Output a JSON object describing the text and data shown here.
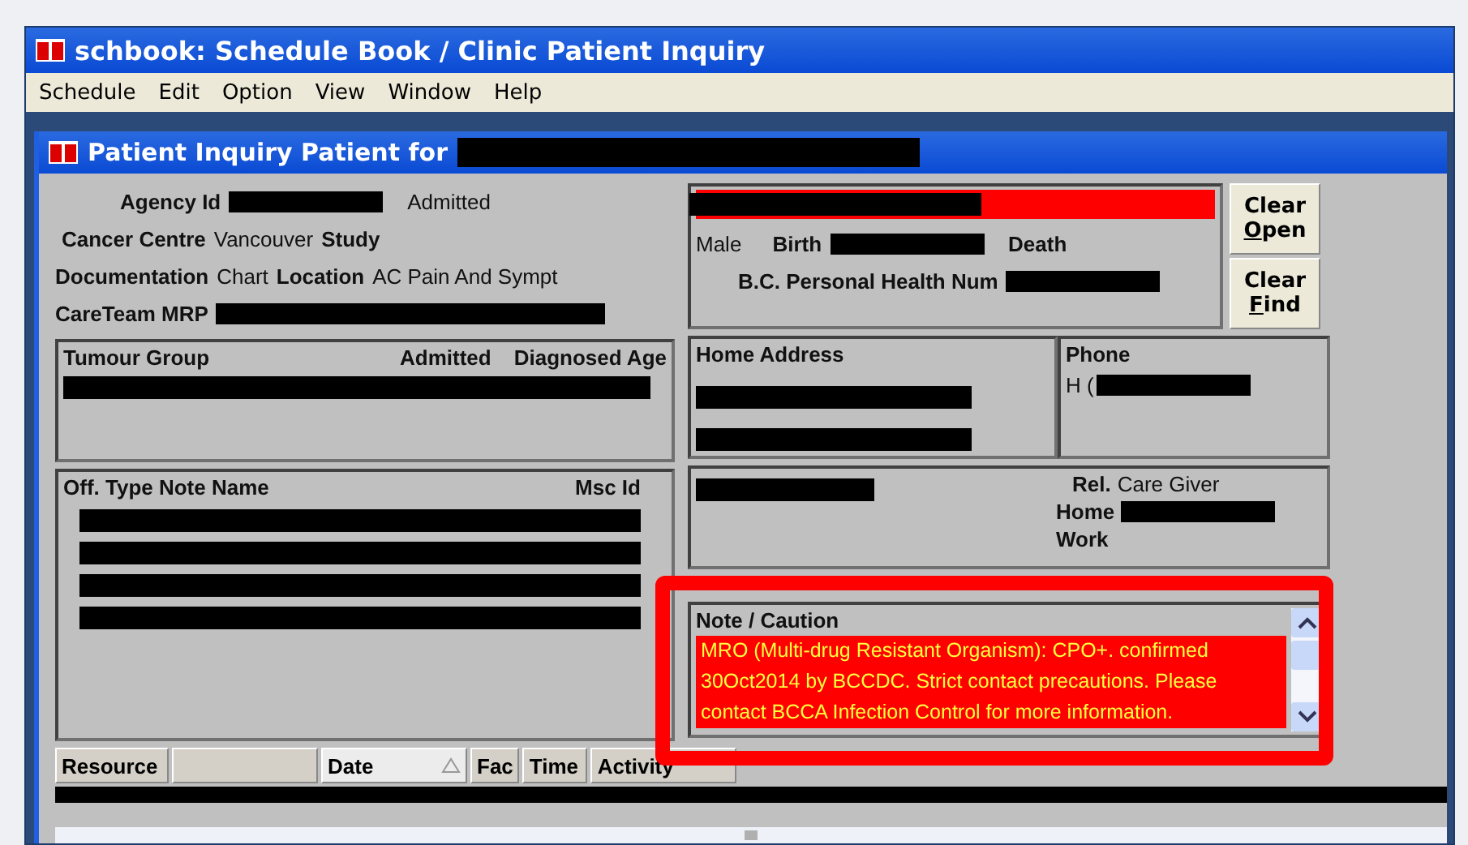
{
  "window": {
    "title": "schbook: Schedule Book / Clinic Patient Inquiry"
  },
  "menu": [
    "Schedule",
    "Edit",
    "Option",
    "View",
    "Window",
    "Help"
  ],
  "inquiry": {
    "title": "Patient Inquiry  Patient  for"
  },
  "info_rows": [
    [
      {
        "kind": "label",
        "text": "Agency Id"
      },
      {
        "kind": "redacted"
      },
      {
        "kind": "value",
        "text": "Admitted"
      }
    ],
    [
      {
        "kind": "label",
        "text": "Cancer Centre"
      },
      {
        "kind": "value",
        "text": "Vancouver"
      },
      {
        "kind": "label",
        "text": "Study"
      }
    ],
    [
      {
        "kind": "label",
        "text": "Documentation"
      },
      {
        "kind": "value",
        "text": "Chart"
      },
      {
        "kind": "label",
        "text": "Location"
      },
      {
        "kind": "value",
        "text": "AC Pain And Sympt"
      }
    ],
    [
      {
        "kind": "label",
        "text": "CareTeam MRP"
      },
      {
        "kind": "redacted"
      }
    ]
  ],
  "patient": {
    "gender": "Male",
    "birth_label": "Birth",
    "death_label": "Death",
    "health_num_label": "B.C. Personal Health Num"
  },
  "buttons": [
    {
      "lines": [
        "Clear",
        "Open"
      ]
    },
    {
      "lines": [
        "Clear",
        "Find"
      ]
    }
  ],
  "tumour": {
    "columns": [
      "Tumour Group",
      "Admitted",
      "Diagnosed Age"
    ]
  },
  "address": {
    "title": "Home Address"
  },
  "phone": {
    "title": "Phone",
    "prefix": "H ("
  },
  "notes_list": {
    "columns": [
      "Off. Type Note Name",
      "Msc Id"
    ]
  },
  "contact": {
    "rows": [
      [
        {
          "kind": "label",
          "text": "Rel."
        },
        {
          "kind": "value",
          "text": "Care Giver"
        }
      ],
      [
        {
          "kind": "label",
          "text": "Home"
        },
        {
          "kind": "redacted"
        }
      ],
      [
        {
          "kind": "label",
          "text": "Work"
        }
      ]
    ]
  },
  "caution": {
    "title": "Note / Caution",
    "text": "MRO (Multi-drug Resistant Organism): CPO+. confirmed 30Oct2014 by BCCDC. Strict contact precautions. Please contact BCCA Infection Control for more information."
  },
  "schedule": {
    "columns": [
      {
        "label": "Resource",
        "sorted": false
      },
      {
        "sorted": false
      },
      {
        "label": "Date",
        "sorted": true
      },
      {
        "label": "Fac",
        "sorted": false
      },
      {
        "label": "Time",
        "sorted": false
      },
      {
        "label": "Activity",
        "sorted": false
      }
    ]
  },
  "highlight": true
}
